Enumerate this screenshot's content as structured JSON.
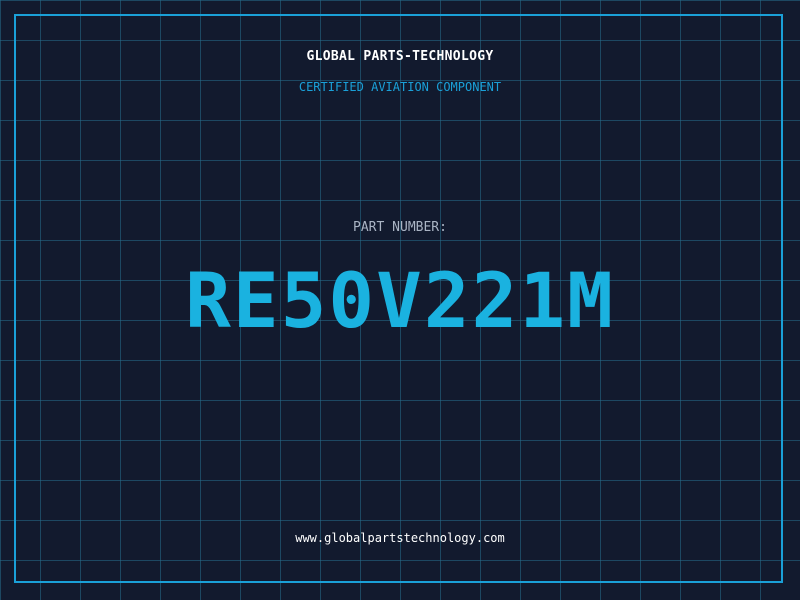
{
  "header": {
    "brand": "GLOBAL PARTS-TECHNOLOGY",
    "subtitle": "CERTIFIED AVIATION COMPONENT"
  },
  "part": {
    "label": "PART NUMBER:",
    "number": "RE50V221M"
  },
  "footer": {
    "website": "www.globalpartstechnology.com"
  },
  "colors": {
    "background": "#121a2e",
    "grid": "#266e8c",
    "accent": "#1aa0d8",
    "part_number": "#1ab2e0",
    "label": "#aab4c4",
    "text": "#ffffff"
  }
}
